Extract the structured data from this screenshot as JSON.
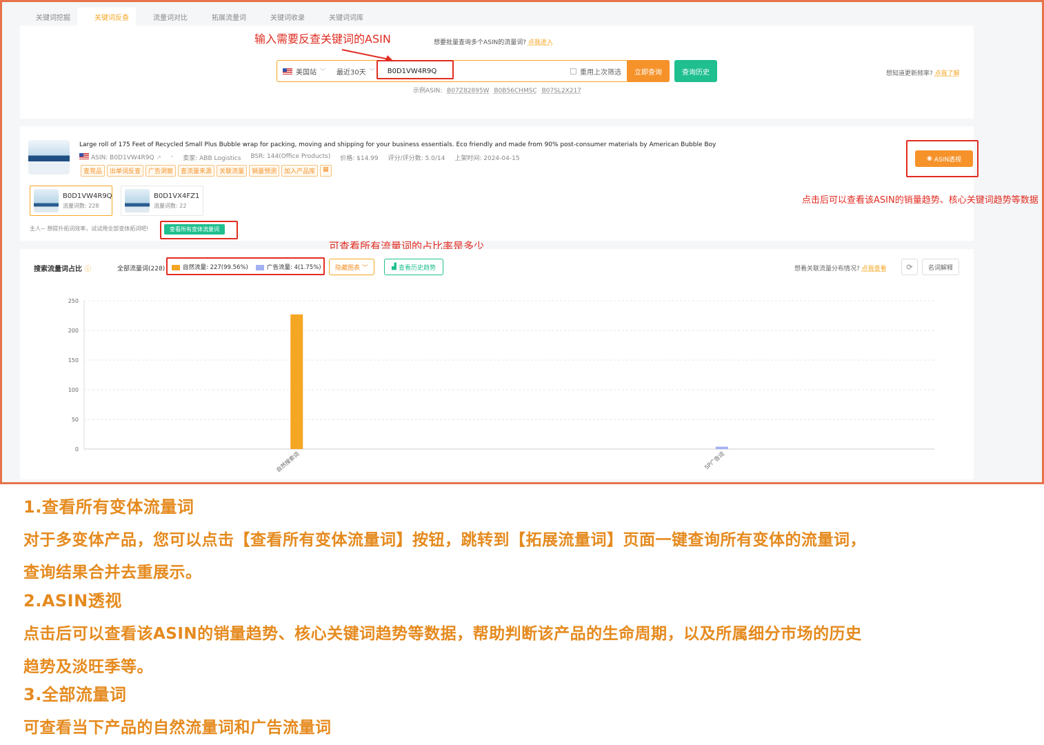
{
  "tabs": [
    "关键词挖掘",
    "关键词反查",
    "流量词对比",
    "拓展流量词",
    "关键词收录",
    "关键词词库"
  ],
  "active_tab_index": 1,
  "search": {
    "annotation": "输入需要反查关键词的ASIN",
    "batch_hint": "想要批量查询多个ASIN的流量词?",
    "batch_link": "点我进入",
    "site": "美国站",
    "period": "最近30天",
    "asin_value": "B0D1VW4R9Q",
    "reuse_filter": "重用上次筛选",
    "query_button": "立即查询",
    "history_button": "查询历史",
    "update_hint": "想知道更新频率?",
    "update_link": "点我了解",
    "examples_label": "示例ASIN:",
    "examples": [
      "B07Z82895W",
      "B0B56CHMSC",
      "B07SL2X217"
    ]
  },
  "product": {
    "title": "Large roll of 175 Feet of Recycled Small Plus Bubble wrap for packing, moving and shipping for your business essentials. Eco friendly and made from 90% post-consumer materials by American Bubble Boy",
    "asin": "ASIN: B0D1VW4R9Q",
    "dash": "-",
    "seller": "卖家: ABB Logistics",
    "bsr": "BSR: 144(Office Products)",
    "price": "价格: $14.99",
    "rating": "评分/评分数: 5.0/14",
    "launch": "上架时间: 2024-04-15",
    "tags": [
      "查竞品",
      "出单词反查",
      "广告洞察",
      "查流量来源",
      "关联流量",
      "销量预测",
      "加入产品库"
    ],
    "asin_insight_button": "ASIN透视",
    "annotation_right": "点击后可以查看该ASIN的销量趋势、核心关键词趋势等数据",
    "variants": [
      {
        "asin": "B0D1VW4R9Q",
        "count": "流量词数: 228"
      },
      {
        "asin": "B0D1VX4FZ1",
        "count": "流量词数: 22"
      }
    ],
    "variant_tip": "主人~ 想提升拓词效率，试试用全部变体拓词吧!",
    "all_variants_button": "查看所有变体流量词"
  },
  "chart_section": {
    "annotation": "可查看所有流量词的占比率是多少",
    "title": "搜索流量词占比",
    "total": "全部流量词(228)",
    "legend_natural": "自然流量: 227(99.56%)",
    "legend_ad": "广告流量: 4(1.75%)",
    "hide_chart": "隐藏图表",
    "history_trend": "查看历史趋势",
    "assoc_hint": "想看关联流量分布情况?",
    "assoc_link": "点我查看",
    "glossary": "名词解释",
    "colors": {
      "natural": "#f5a623",
      "ad": "#a3b1f0"
    }
  },
  "chart_data": {
    "type": "bar",
    "categories": [
      "自然搜索词",
      "SP广告词"
    ],
    "values": [
      227,
      4
    ],
    "ylim": [
      0,
      250
    ],
    "yticks": [
      0,
      50,
      100,
      150,
      200,
      250
    ],
    "grid": true
  },
  "notes": {
    "h1": "1.查看所有变体流量词",
    "p1a": "对于多变体产品，您可以点击【查看所有变体流量词】按钮，跳转到【拓展流量词】页面一键查询所有变体的流量词，",
    "p1b": "查询结果合并去重展示。",
    "h2": "2.ASIN透视",
    "p2a": "点击后可以查看该ASIN的销量趋势、核心关键词趋势等数据，帮助判断该产品的生命周期，以及所属细分市场的历史",
    "p2b": "趋势及淡旺季等。",
    "h3": "3.全部流量词",
    "p3": "可查看当下产品的自然流量词和广告流量词"
  }
}
